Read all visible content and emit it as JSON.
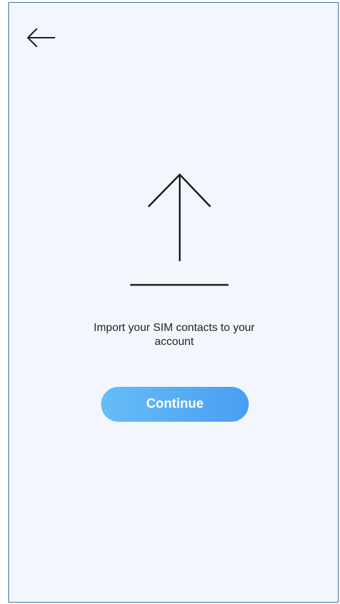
{
  "header": {
    "back_icon": "arrow-left-icon"
  },
  "illustration": {
    "icon": "upload-arrow-icon"
  },
  "message": {
    "line1": "Import your SIM contacts to your",
    "line2": "account"
  },
  "actions": {
    "continue_label": "Continue"
  },
  "colors": {
    "background": "#f3f7fd",
    "frame_border": "#3b6fb0",
    "button_gradient_start": "#66bdf7",
    "button_gradient_end": "#4a9ef2",
    "text": "#1f1f1f"
  }
}
